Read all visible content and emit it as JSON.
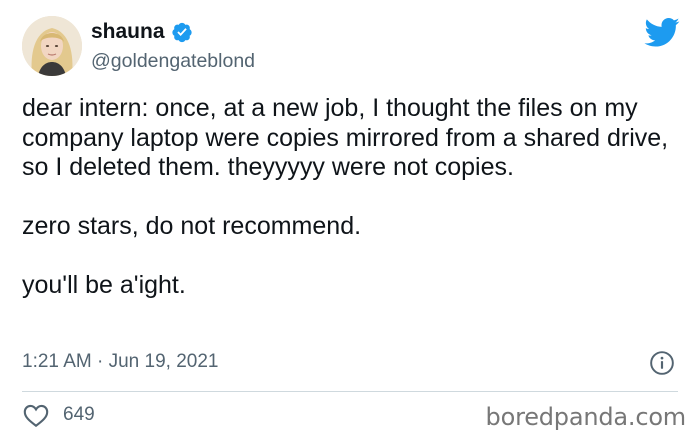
{
  "user": {
    "display_name": "shauna",
    "handle": "@goldengateblond",
    "verified": true
  },
  "tweet": {
    "paragraphs": [
      "dear intern: once, at a new job, I thought the files on my company laptop were copies mirrored from a shared drive, so I deleted them. theyyyyy were not copies.",
      "zero stars, do not recommend.",
      "you'll be a'ight."
    ],
    "timestamp": "1:21 AM · Jun 19, 2021"
  },
  "stats": {
    "likes": "649"
  },
  "watermark": "boredpanda.com",
  "icons": {
    "avatar": "avatar-photo",
    "verified": "verified-badge-icon",
    "brand": "twitter-bird-icon",
    "info": "info-icon",
    "like": "heart-icon"
  },
  "colors": {
    "brand": "#1d9bf0",
    "text": "#0f1419",
    "secondary": "#536471",
    "divider": "#cfd9de"
  }
}
